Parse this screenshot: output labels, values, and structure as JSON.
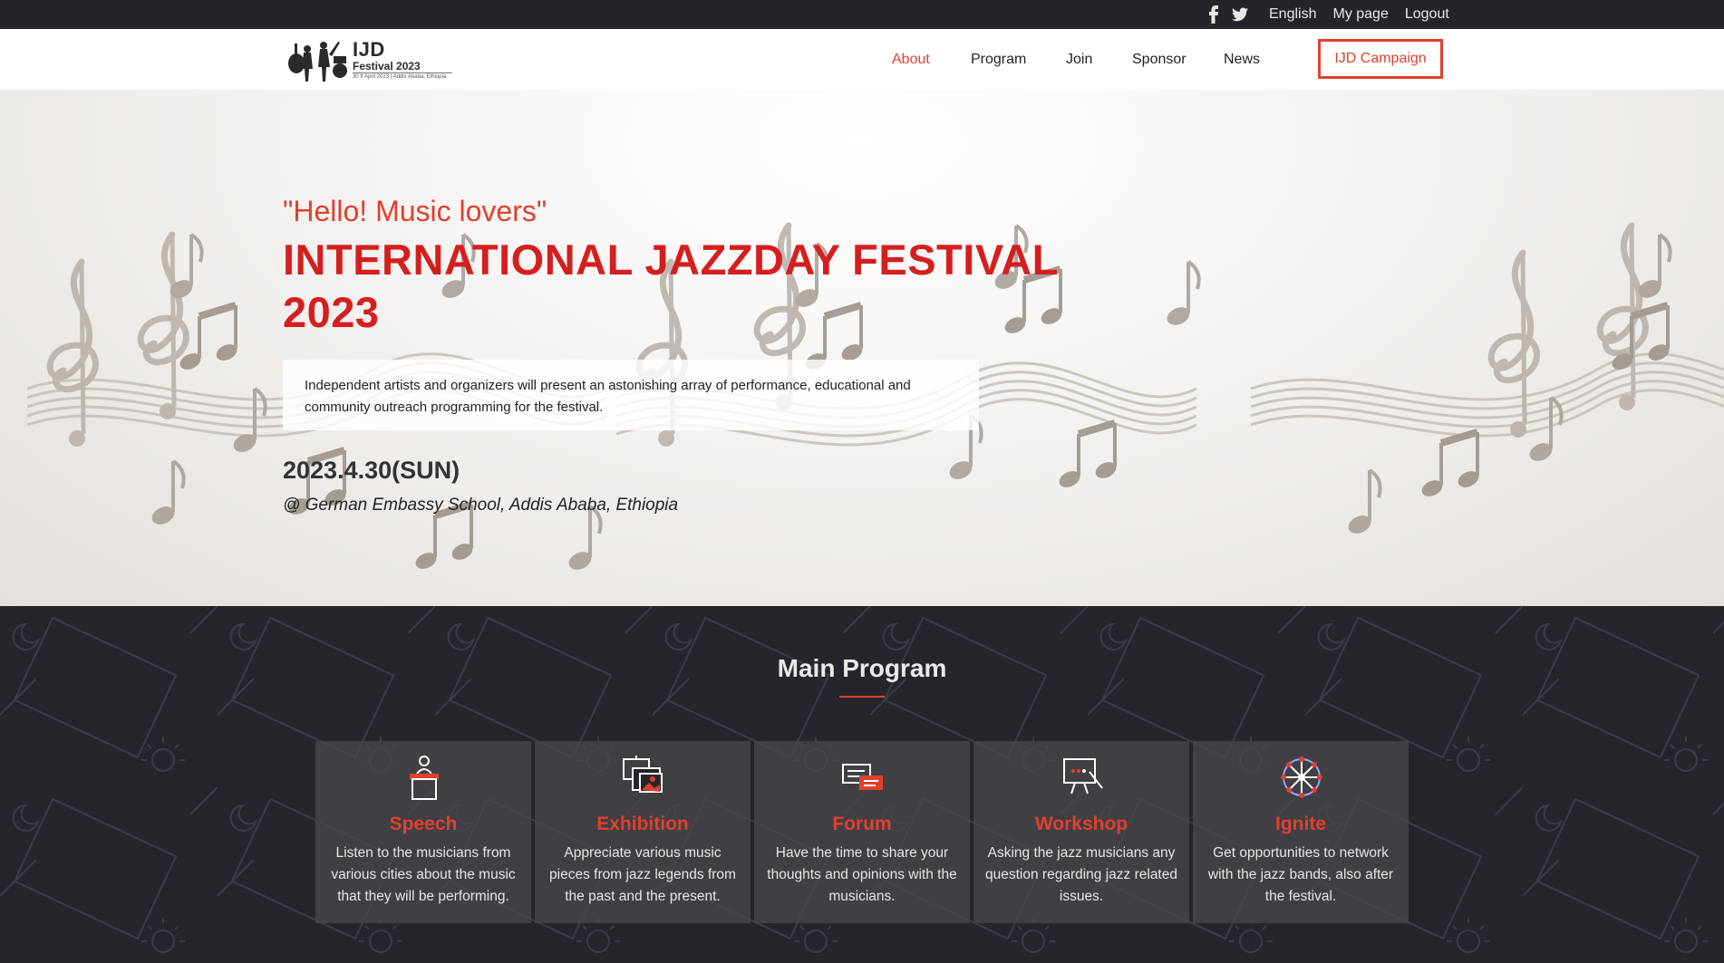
{
  "topbar": {
    "social": [
      "facebook-icon",
      "twitter-icon"
    ],
    "links": [
      "English",
      "My page",
      "Logout"
    ]
  },
  "header": {
    "logo": {
      "line1": "IJD",
      "line2": "Festival 2023",
      "line3": "30 ft April 2023 | Addis Ababa, Ethiopia"
    },
    "nav": [
      "About",
      "Program",
      "Join",
      "Sponsor",
      "News"
    ],
    "active_nav": "About",
    "campaign_label": "IJD Campaign"
  },
  "hero": {
    "greeting": "\"Hello! Music lovers\"",
    "title": "INTERNATIONAL JAZZDAY FESTIVAL 2023",
    "description": "Independent artists and organizers will present an astonishing array of performance, educational and community outreach programming for the festival.",
    "date": "2023.4.30(SUN)",
    "venue": "@ German Embassy School, Addis Ababa, Ethiopia"
  },
  "program": {
    "heading": "Main Program",
    "cards": [
      {
        "name": "Speech",
        "icon": "podium-speaker-icon",
        "text": "Listen to the musicians from various cities about the music that they will be performing."
      },
      {
        "name": "Exhibition",
        "icon": "gallery-frames-icon",
        "text": "Appreciate various music pieces from jazz legends from the past and the present."
      },
      {
        "name": "Forum",
        "icon": "chat-bubbles-icon",
        "text": "Have the time to share your thoughts and opinions with the musicians."
      },
      {
        "name": "Workshop",
        "icon": "presentation-board-icon",
        "text": "Asking the jazz musicians any question regarding jazz related issues."
      },
      {
        "name": "Ignite",
        "icon": "network-wheel-icon",
        "text": "Get opportunities to network with the jazz bands, also after the festival."
      }
    ]
  },
  "colors": {
    "accent": "#e0402e",
    "title_red": "#d41f1f",
    "dark": "#24252b"
  }
}
